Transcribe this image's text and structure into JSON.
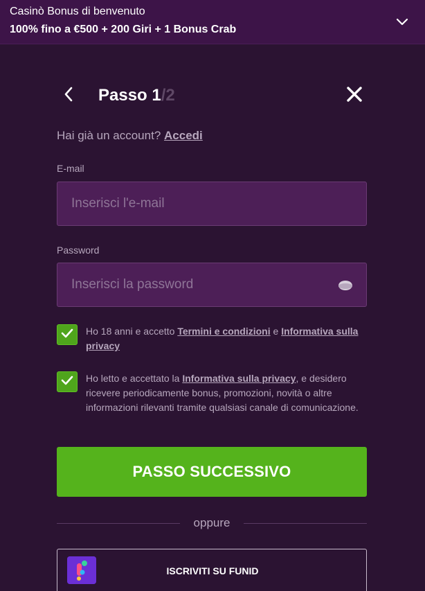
{
  "banner": {
    "title": "Casinò Bonus di benvenuto",
    "offer": "100% fino a €500 + 200 Giri + 1 Bonus Crab",
    "toggle_icon": "chevron-down-icon"
  },
  "header": {
    "step_label": "Passo 1",
    "step_total": "/2",
    "back_icon": "chevron-left-icon",
    "close_icon": "close-icon"
  },
  "login": {
    "prompt": "Hai già un account?",
    "link": "Accedi"
  },
  "email": {
    "label": "E-mail",
    "placeholder": "Inserisci l'e-mail",
    "value": ""
  },
  "password": {
    "label": "Password",
    "placeholder": "Inserisci la password",
    "value": "",
    "toggle_icon": "eye-icon"
  },
  "consent_terms": {
    "checked": true,
    "text_1": "Ho 18 anni e accetto ",
    "link_1": "Termini e condizioni",
    "text_2": " e ",
    "link_2": "Informativa sulla privacy"
  },
  "consent_marketing": {
    "checked": true,
    "text_1": "Ho letto e accettato la ",
    "link_1": "Informativa sulla privacy",
    "text_2": ", e desidero ricevere periodicamente bonus, promozioni, novità o altre informazioni rilevanti tramite qualsiasi canale di comunicazione."
  },
  "next_button": {
    "label": "PASSO SUCCESSIVO"
  },
  "divider": {
    "label": "oppure"
  },
  "funid": {
    "label": "ISCRIVITI SU FUNID",
    "logo_icon": "funid-logo-icon"
  },
  "colors": {
    "background": "#2b1332",
    "banner": "#3d1448",
    "input": "#4d1f57",
    "accent_green": "#55b31c",
    "muted_text": "#b7a7bd"
  }
}
